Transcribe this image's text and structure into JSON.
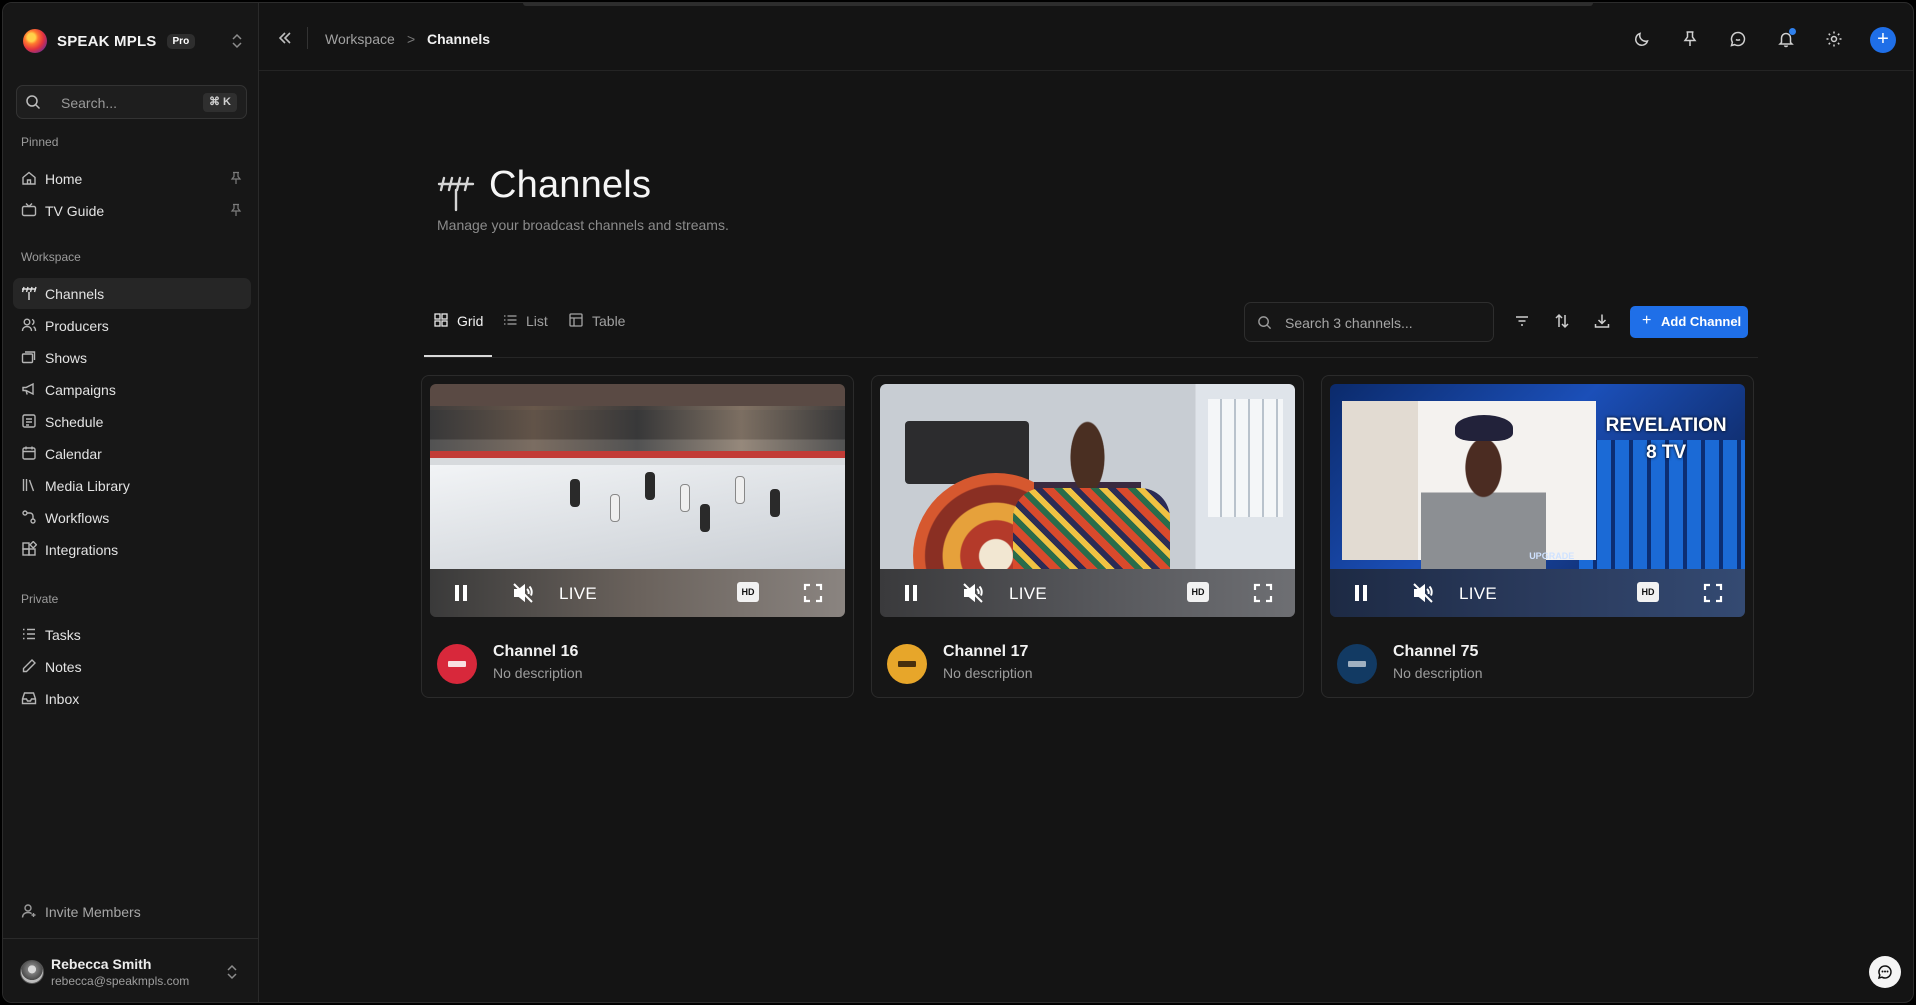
{
  "app": {
    "brand_name": "SPEAK MPLS",
    "plan_badge": "Pro",
    "accent_color": "#1f6fe8"
  },
  "sidebar": {
    "search_placeholder": "Search...",
    "search_shortcut": "⌘ K",
    "pinned_label": "Pinned",
    "pinned_items": [
      {
        "label": "Home",
        "icon": "home-icon"
      },
      {
        "label": "TV Guide",
        "icon": "tv-icon"
      }
    ],
    "workspace_label": "Workspace",
    "workspace_items": [
      {
        "label": "Channels",
        "icon": "antenna-icon",
        "active": true
      },
      {
        "label": "Producers",
        "icon": "users-icon"
      },
      {
        "label": "Shows",
        "icon": "layers-icon"
      },
      {
        "label": "Campaigns",
        "icon": "megaphone-icon"
      },
      {
        "label": "Schedule",
        "icon": "schedule-icon"
      },
      {
        "label": "Calendar",
        "icon": "calendar-icon"
      },
      {
        "label": "Media Library",
        "icon": "library-icon"
      },
      {
        "label": "Workflows",
        "icon": "workflow-icon"
      },
      {
        "label": "Integrations",
        "icon": "integrations-icon"
      }
    ],
    "private_label": "Private",
    "private_items": [
      {
        "label": "Tasks",
        "icon": "tasks-icon"
      },
      {
        "label": "Notes",
        "icon": "pencil-icon"
      },
      {
        "label": "Inbox",
        "icon": "inbox-icon"
      }
    ],
    "invite_label": "Invite Members",
    "user": {
      "name": "Rebecca Smith",
      "email": "rebecca@speakmpls.com"
    }
  },
  "topbar": {
    "breadcrumb": [
      "Workspace",
      "Channels"
    ],
    "breadcrumb_separator": ">"
  },
  "page": {
    "title": "Channels",
    "subtitle": "Manage your broadcast channels and streams.",
    "view_tabs": [
      {
        "label": "Grid",
        "icon": "grid-icon",
        "active": true
      },
      {
        "label": "List",
        "icon": "list-icon"
      },
      {
        "label": "Table",
        "icon": "table-icon"
      }
    ],
    "search_placeholder": "Search 3 channels...",
    "add_button_label": "Add Channel",
    "add_button_symbol": "+"
  },
  "channels": [
    {
      "name": "Channel 16",
      "description": "No description",
      "status": "LIVE",
      "quality": "HD",
      "logo_color": "#d8283b",
      "video": "hockey"
    },
    {
      "name": "Channel 17",
      "description": "No description",
      "status": "LIVE",
      "quality": "HD",
      "logo_color": "#e7a62a",
      "video": "office"
    },
    {
      "name": "Channel 75",
      "description": "No description",
      "status": "LIVE",
      "quality": "HD",
      "logo_color": "#123a63",
      "video": "revelation",
      "video_text": [
        "REVELATION",
        "8 TV"
      ],
      "video_caption": "UPGRADE"
    }
  ]
}
